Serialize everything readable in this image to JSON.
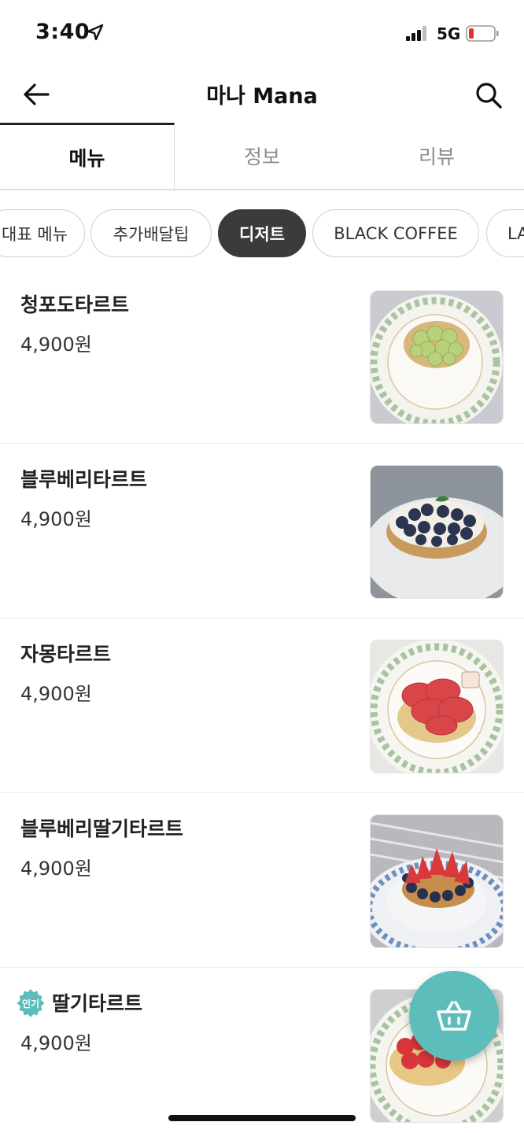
{
  "status_bar": {
    "time": "3:40",
    "network": "5G",
    "battery_color": "#e2322b"
  },
  "header": {
    "title": "마나 Mana",
    "back_icon": "arrow-left-icon",
    "search_icon": "search-icon"
  },
  "tabs": [
    {
      "label": "메뉴",
      "active": true
    },
    {
      "label": "정보",
      "active": false
    },
    {
      "label": "리뷰",
      "active": false
    }
  ],
  "categories": [
    {
      "label": "대표 메뉴",
      "active": false
    },
    {
      "label": "추가배달팁",
      "active": false
    },
    {
      "label": "디저트",
      "active": true
    },
    {
      "label": "BLACK COFFEE",
      "active": false
    },
    {
      "label": "LA",
      "active": false
    }
  ],
  "menu_items": [
    {
      "name": "청포도타르트",
      "price": "4,900원",
      "image": "green-grape-tart-photo"
    },
    {
      "name": "블루베리타르트",
      "price": "4,900원",
      "image": "blueberry-tart-photo"
    },
    {
      "name": "자몽타르트",
      "price": "4,900원",
      "image": "grapefruit-tart-photo"
    },
    {
      "name": "블루베리딸기타르트",
      "price": "4,900원",
      "image": "blueberry-strawberry-tart-photo"
    },
    {
      "name": "딸기타르트",
      "price": "4,900원",
      "image": "strawberry-tart-photo",
      "badge": "인기"
    }
  ],
  "cart": {
    "icon": "shopping-basket-icon",
    "color": "#5dbdbb"
  },
  "colors": {
    "accent": "#5dbdbb",
    "active_chip": "#3b3b3b"
  }
}
